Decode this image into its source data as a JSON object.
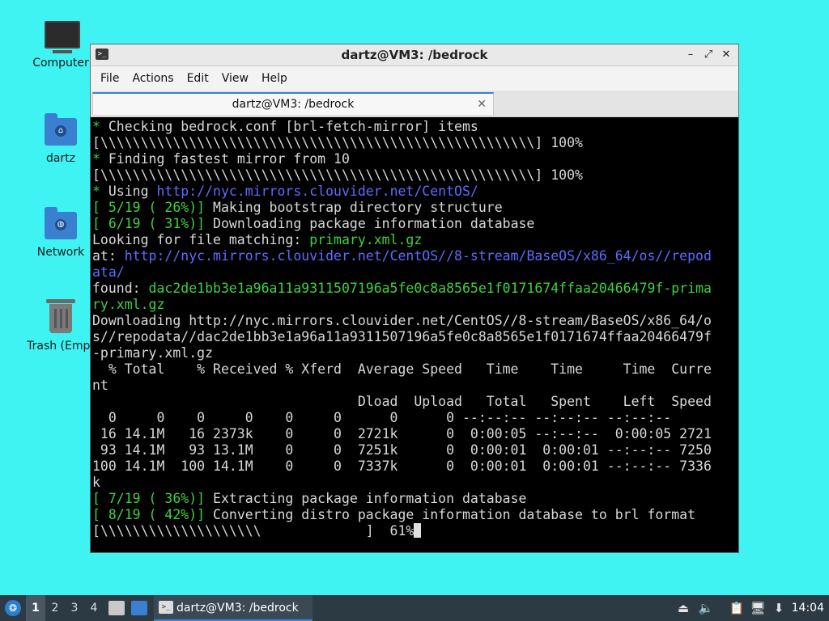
{
  "desktop": {
    "icons": [
      {
        "label": "Computer",
        "icon": "computer-icon"
      },
      {
        "label": "dartz",
        "icon": "home-folder-icon"
      },
      {
        "label": "Network",
        "icon": "network-folder-icon"
      },
      {
        "label": "Trash (Empt",
        "icon": "trash-icon"
      }
    ]
  },
  "window": {
    "title": "dartz@VM3: /bedrock",
    "controls": {
      "minimize": "–",
      "maximize": "⤢",
      "close": "✕"
    },
    "menu": [
      "File",
      "Actions",
      "Edit",
      "View",
      "Help"
    ],
    "tab": {
      "title": "dartz@VM3: /bedrock",
      "close": "✕"
    }
  },
  "terminal": {
    "lines": [
      [
        {
          "t": "* ",
          "c": "g"
        },
        {
          "t": "Checking bedrock.conf [brl-fetch-mirror] items"
        }
      ],
      [
        {
          "t": "[\\\\\\\\\\\\\\\\\\\\\\\\\\\\\\\\\\\\\\\\\\\\\\\\\\\\\\\\\\\\\\\\\\\\\\\\\\\\\\\\\\\\\\\\\\\\\\\\\\\\\\\\\\\\] 100%"
        }
      ],
      [
        {
          "t": "* ",
          "c": "g"
        },
        {
          "t": "Finding fastest mirror from 10"
        }
      ],
      [
        {
          "t": "[\\\\\\\\\\\\\\\\\\\\\\\\\\\\\\\\\\\\\\\\\\\\\\\\\\\\\\\\\\\\\\\\\\\\\\\\\\\\\\\\\\\\\\\\\\\\\\\\\\\\\\\\\\\\] 100%"
        }
      ],
      [
        {
          "t": "* ",
          "c": "g"
        },
        {
          "t": "Using "
        },
        {
          "t": "http://nyc.mirrors.clouvider.net/CentOS/",
          "c": "b"
        }
      ],
      [
        {
          "t": "[ 5/19 ( 26%)]",
          "c": "g"
        },
        {
          "t": " Making bootstrap directory structure"
        }
      ],
      [
        {
          "t": "[ 6/19 ( 31%)]",
          "c": "g"
        },
        {
          "t": " Downloading package information database"
        }
      ],
      [
        {
          "t": "Looking for file matching: "
        },
        {
          "t": "primary.xml.gz",
          "c": "g"
        }
      ],
      [
        {
          "t": "at: "
        },
        {
          "t": "http://nyc.mirrors.clouvider.net/CentOS//8-stream/BaseOS/x86_64/os//repod",
          "c": "b"
        }
      ],
      [
        {
          "t": "ata/",
          "c": "b"
        }
      ],
      [
        {
          "t": "found: "
        },
        {
          "t": "dac2de1bb3e1a96a11a9311507196a5fe0c8a8565e1f0171674ffaa20466479f-prima",
          "c": "g"
        }
      ],
      [
        {
          "t": "ry.xml.gz",
          "c": "g"
        }
      ],
      [
        {
          "t": "Downloading http://nyc.mirrors.clouvider.net/CentOS//8-stream/BaseOS/x86_64/o"
        }
      ],
      [
        {
          "t": "s//repodata//dac2de1bb3e1a96a11a9311507196a5fe0c8a8565e1f0171674ffaa20466479f"
        }
      ],
      [
        {
          "t": "-primary.xml.gz"
        }
      ],
      [
        {
          "t": "  % Total    % Received % Xferd  Average Speed   Time    Time     Time  Curre"
        }
      ],
      [
        {
          "t": "nt"
        }
      ],
      [
        {
          "t": "                                 Dload  Upload   Total   Spent    Left  Speed"
        }
      ],
      [
        {
          "t": "  0     0    0     0    0     0      0      0 --:--:-- --:--:-- --:--:--     "
        }
      ],
      [
        {
          "t": " 16 14.1M   16 2373k    0     0  2721k      0  0:00:05 --:--:--  0:00:05 2721"
        }
      ],
      [
        {
          "t": " 93 14.1M   93 13.1M    0     0  7251k      0  0:00:01  0:00:01 --:--:-- 7250"
        }
      ],
      [
        {
          "t": "100 14.1M  100 14.1M    0     0  7337k      0  0:00:01  0:00:01 --:--:-- 7336"
        }
      ],
      [
        {
          "t": "k"
        }
      ],
      [
        {
          "t": "[ 7/19 ( 36%)]",
          "c": "g"
        },
        {
          "t": " Extracting package information database"
        }
      ],
      [
        {
          "t": "[ 8/19 ( 42%)]",
          "c": "g"
        },
        {
          "t": " Converting distro package information database to brl format"
        }
      ],
      [
        {
          "t": "[\\\\\\\\\\\\\\\\\\\\\\\\\\\\\\\\\\\\\\\\             ]  61%"
        },
        {
          "t": "",
          "c": "cursor"
        }
      ]
    ]
  },
  "taskbar": {
    "workspaces": [
      "1",
      "2",
      "3",
      "4"
    ],
    "active_workspace": "1",
    "task_title": "dartz@VM3: /bedrock",
    "clock": "14:04"
  }
}
